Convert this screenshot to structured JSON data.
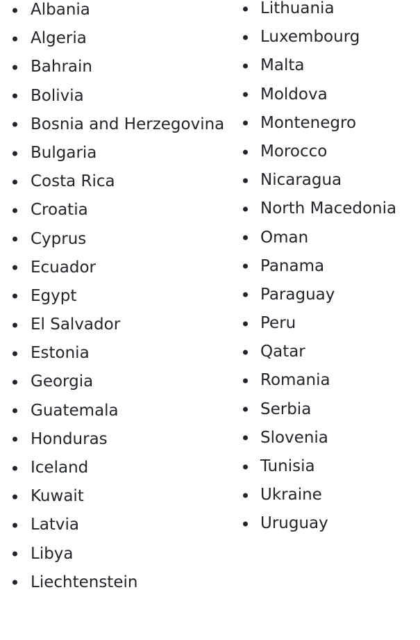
{
  "countries_left": [
    "Albania",
    "Algeria",
    "Bahrain",
    "Bolivia",
    "Bosnia and Herzegovina",
    "Bulgaria",
    "Costa Rica",
    "Croatia",
    "Cyprus",
    "Ecuador",
    "Egypt",
    "El Salvador",
    "Estonia",
    "Georgia",
    "Guatemala",
    "Honduras",
    "Iceland",
    "Kuwait",
    "Latvia",
    "Libya",
    "Liechtenstein"
  ],
  "countries_right": [
    "Lithuania",
    "Luxembourg",
    "Malta",
    "Moldova",
    "Montenegro",
    "Morocco",
    "Nicaragua",
    "North Macedonia",
    "Oman",
    "Panama",
    "Paraguay",
    "Peru",
    "Qatar",
    "Romania",
    "Serbia",
    "Slovenia",
    "Tunisia",
    "Ukraine",
    "Uruguay"
  ]
}
